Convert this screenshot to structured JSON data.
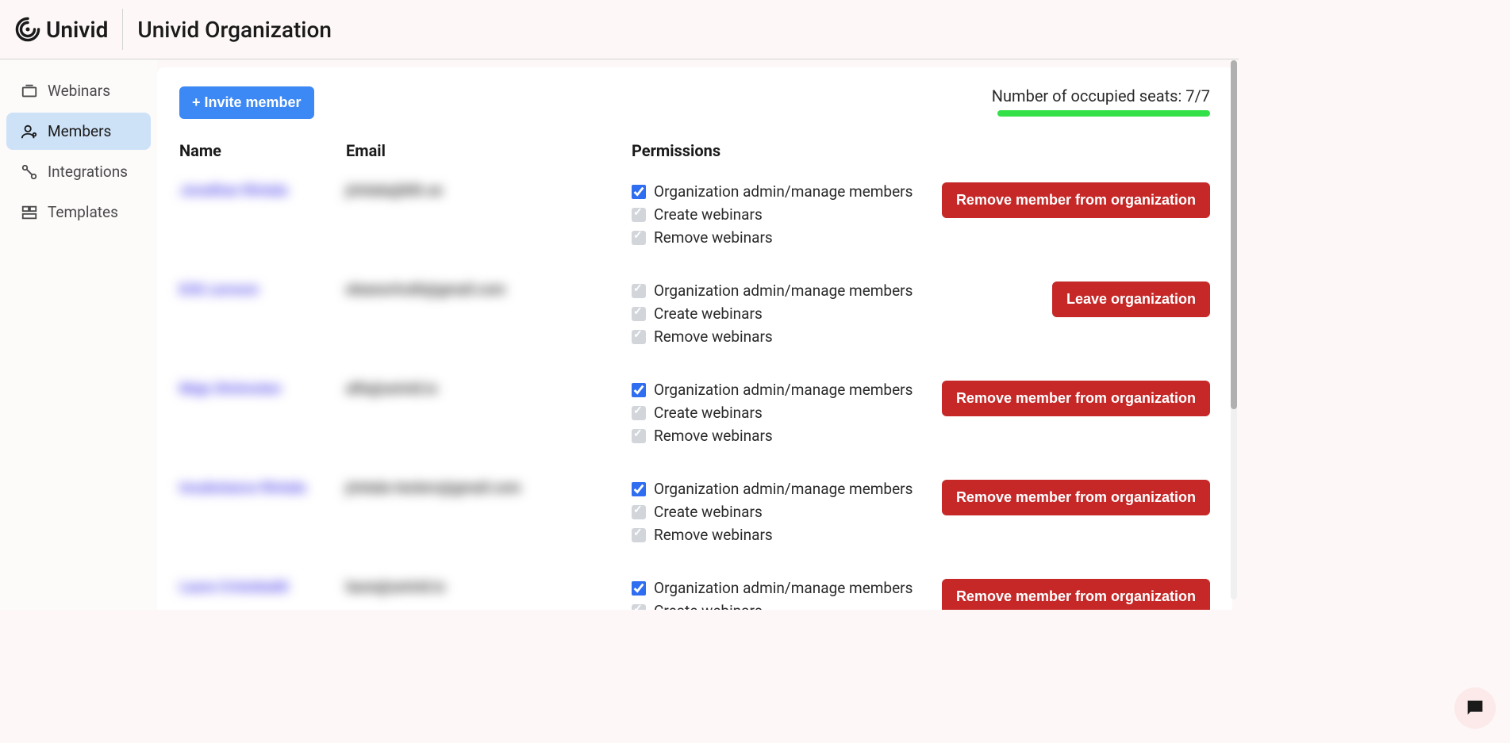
{
  "header": {
    "brand": "Univid",
    "orgTitle": "Univid Organization"
  },
  "sidebar": {
    "items": [
      {
        "label": "Webinars",
        "icon": "webinar-icon",
        "active": false
      },
      {
        "label": "Members",
        "icon": "members-icon",
        "active": true
      },
      {
        "label": "Integrations",
        "icon": "integrations-icon",
        "active": false
      },
      {
        "label": "Templates",
        "icon": "templates-icon",
        "active": false
      }
    ]
  },
  "main": {
    "inviteLabel": "+ Invite member",
    "seatsLabel": "Number of occupied seats: 7/7",
    "columns": {
      "name": "Name",
      "email": "Email",
      "permissions": "Permissions"
    },
    "permissionLabels": {
      "admin": "Organization admin/manage members",
      "create": "Create webinars",
      "remove": "Remove webinars"
    },
    "actions": {
      "remove": "Remove member from organization",
      "leave": "Leave organization"
    },
    "members": [
      {
        "name": "Jonathan Rintala",
        "email": "jrintala@kth.se",
        "adminChecked": true,
        "adminEnabled": true,
        "action": "remove"
      },
      {
        "name": "Erik Larsson",
        "email": "eleanortruth@gmail.com",
        "adminChecked": true,
        "adminEnabled": false,
        "action": "leave"
      },
      {
        "name": "Maja Strömsten",
        "email": "alfa@univid.io",
        "adminChecked": true,
        "adminEnabled": true,
        "action": "remove"
      },
      {
        "name": "Insubstance Rintala",
        "email": "jrintala-testers@gmail.com",
        "adminChecked": true,
        "adminEnabled": true,
        "action": "remove"
      },
      {
        "name": "Laura Cristobaldi",
        "email": "laura@univid.io",
        "adminChecked": true,
        "adminEnabled": true,
        "action": "remove"
      }
    ]
  }
}
